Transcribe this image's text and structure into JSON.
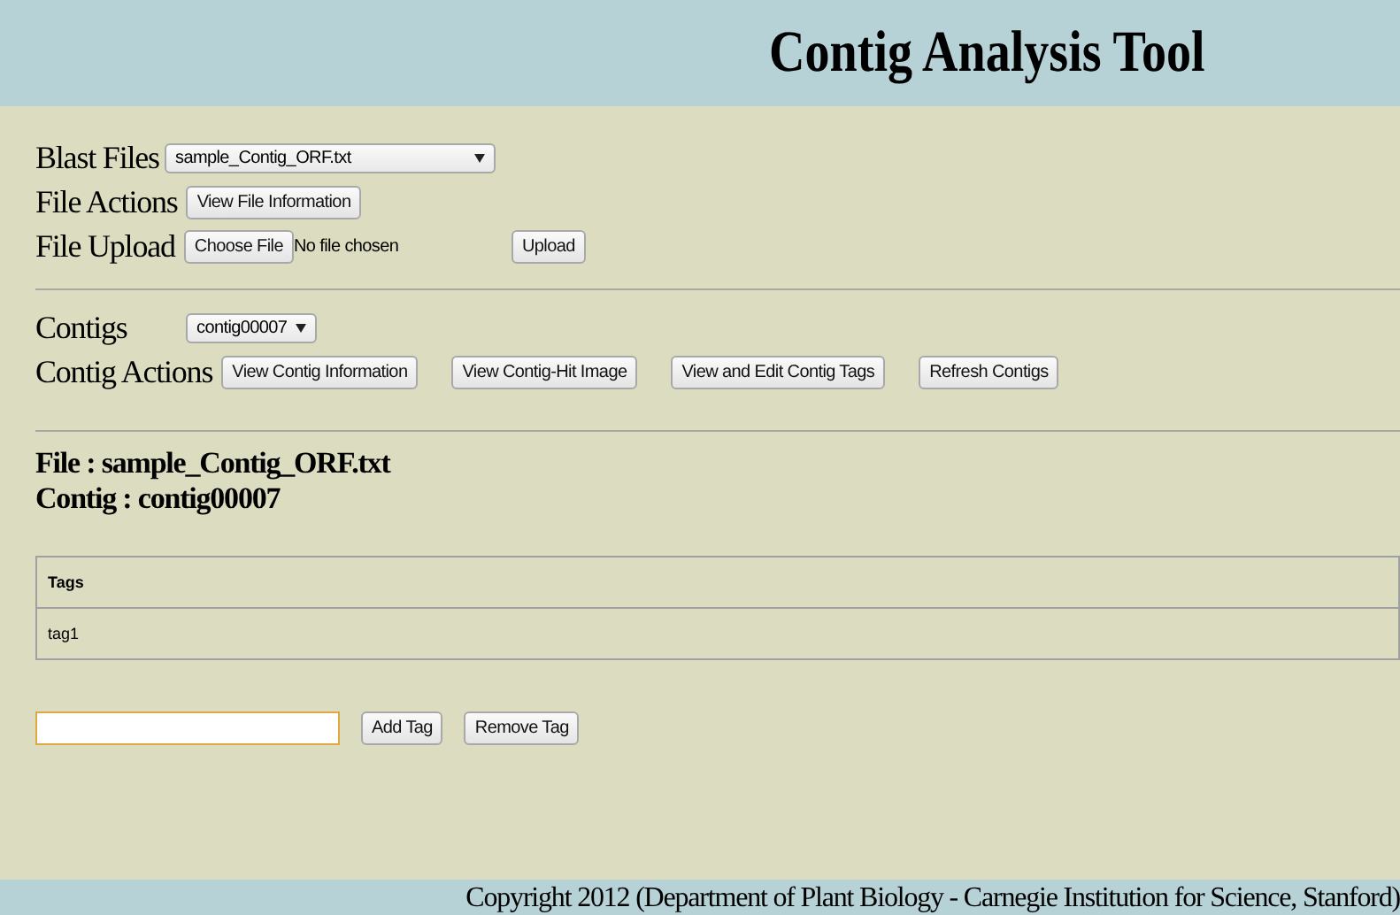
{
  "header": {
    "title": "Contig Analysis Tool"
  },
  "file_section": {
    "blast_files_label": "Blast Files",
    "blast_file_value": "sample_Contig_ORF.txt",
    "file_actions_label": "File Actions",
    "view_file_button": "View File Information",
    "file_upload_label": "File Upload",
    "choose_file_button": "Choose File",
    "no_file_text": "No file chosen",
    "upload_button": "Upload"
  },
  "contig_section": {
    "contigs_label": "Contigs",
    "contig_value": "contig00007",
    "contig_actions_label": "Contig Actions",
    "buttons": [
      "View Contig Information",
      "View Contig-Hit Image",
      "View and Edit Contig Tags",
      "Refresh Contigs"
    ]
  },
  "info": {
    "file_line": "File : sample_Contig_ORF.txt",
    "contig_line": "Contig : contig00007"
  },
  "tags_table": {
    "header": "Tags",
    "rows": [
      "tag1"
    ]
  },
  "tag_actions": {
    "add_button": "Add Tag",
    "remove_button": "Remove Tag"
  },
  "footer": {
    "text": "Copyright 2012 (Department of Plant Biology - Carnegie Institution for Science, Stanford)"
  }
}
